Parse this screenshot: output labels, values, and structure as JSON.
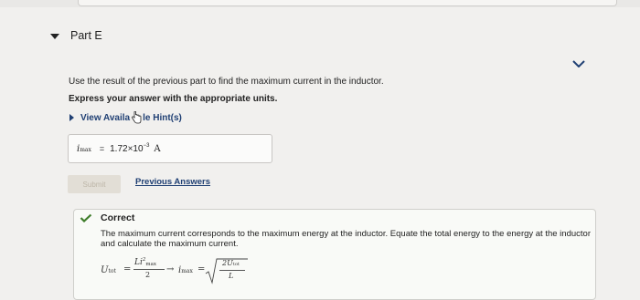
{
  "part": {
    "title": "Part E"
  },
  "question": {
    "text": "Use the result of the previous part to find the maximum current in the inductor.",
    "instruction": "Express your answer with the appropriate units."
  },
  "hints": {
    "label_before": "View Availa",
    "label_after": "le Hint(s)"
  },
  "answer": {
    "variable": "i",
    "variable_sub": "max",
    "equals": "=",
    "mantissa": "1.72×10",
    "exponent": "−3",
    "unit": "A"
  },
  "actions": {
    "submit_label": "Submit",
    "previous_answers_label": "Previous Answers"
  },
  "feedback": {
    "status": "Correct",
    "text": "The maximum current corresponds to the maximum energy at the inductor. Equate the total energy to the energy at the inductor and calculate the maximum current.",
    "formula": {
      "u": "U",
      "u_sub": "tot",
      "eq1": "=",
      "num": "Li",
      "num_sup": "2",
      "num_sub": "max",
      "den": "2",
      "arrow": "→",
      "i": "i",
      "i_sub": "max",
      "eq2": "=",
      "root_num": "2U",
      "root_num_sub": "tot",
      "root_den": "L"
    }
  },
  "colors": {
    "link": "#1f3f73",
    "check": "#3f7d2b",
    "submit_disabled_bg": "#e2ded6"
  }
}
